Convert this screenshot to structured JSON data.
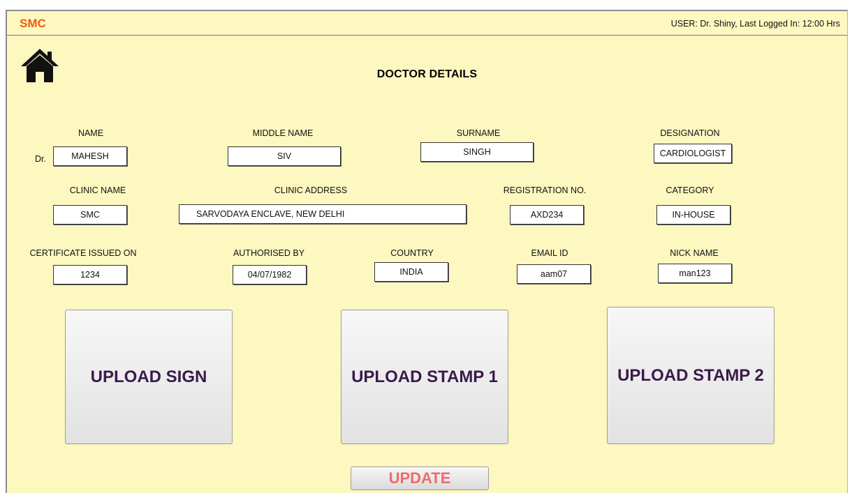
{
  "header": {
    "brand": "SMC",
    "user_info": "USER: Dr. Shiny, Last Logged In: 12:00 Hrs"
  },
  "page_title": "DOCTOR DETAILS",
  "icons": {
    "home": "home-icon"
  },
  "fields": {
    "name": {
      "label": "NAME",
      "prefix": "Dr.",
      "value": "MAHESH"
    },
    "middle_name": {
      "label": "MIDDLE NAME",
      "value": "SIV"
    },
    "surname": {
      "label": "SURNAME",
      "value": "SINGH"
    },
    "designation": {
      "label": "DESIGNATION",
      "value": "CARDIOLOGIST"
    },
    "clinic_name": {
      "label": "CLINIC NAME",
      "value": "SMC"
    },
    "clinic_address": {
      "label": "CLINIC ADDRESS",
      "value": "SARVODAYA ENCLAVE, NEW DELHI"
    },
    "registration_no": {
      "label": "REGISTRATION NO.",
      "value": "AXD234"
    },
    "category": {
      "label": "CATEGORY",
      "value": "IN-HOUSE"
    },
    "certificate_issued_on": {
      "label": "CERTIFICATE ISSUED ON",
      "value": "1234"
    },
    "authorised_by": {
      "label": "AUTHORISED BY",
      "value": "04/07/1982"
    },
    "country": {
      "label": "COUNTRY",
      "value": "INDIA"
    },
    "email_id": {
      "label": "EMAIL ID",
      "value": "aam07"
    },
    "nick_name": {
      "label": "NICK NAME",
      "value": "man123"
    }
  },
  "uploads": {
    "sign": "UPLOAD SIGN",
    "stamp1": "UPLOAD STAMP 1",
    "stamp2": "UPLOAD STAMP 2"
  },
  "update_label": "UPDATE",
  "colors": {
    "background": "#fdf7c0",
    "brand": "#f05a14",
    "upload_text": "#3a1a4a",
    "update_text": "#f06a6a"
  }
}
